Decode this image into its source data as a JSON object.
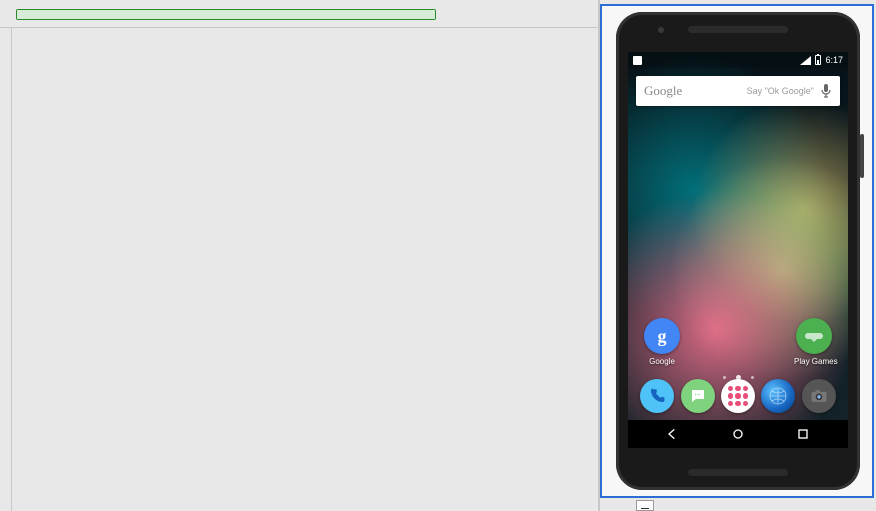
{
  "ide": {
    "progress_pct": 100
  },
  "emulator": {
    "statusbar": {
      "time": "6:17"
    },
    "search": {
      "logo_text": "Google",
      "hint": "Say \"Ok Google\""
    },
    "home_apps": [
      {
        "id": "google",
        "label": "Google"
      },
      {
        "id": "play_games",
        "label": "Play Games"
      }
    ],
    "dock": [
      {
        "id": "phone"
      },
      {
        "id": "messages"
      },
      {
        "id": "all_apps"
      },
      {
        "id": "browser"
      },
      {
        "id": "camera"
      }
    ],
    "navbar": [
      {
        "id": "back"
      },
      {
        "id": "home"
      },
      {
        "id": "recents"
      }
    ]
  }
}
